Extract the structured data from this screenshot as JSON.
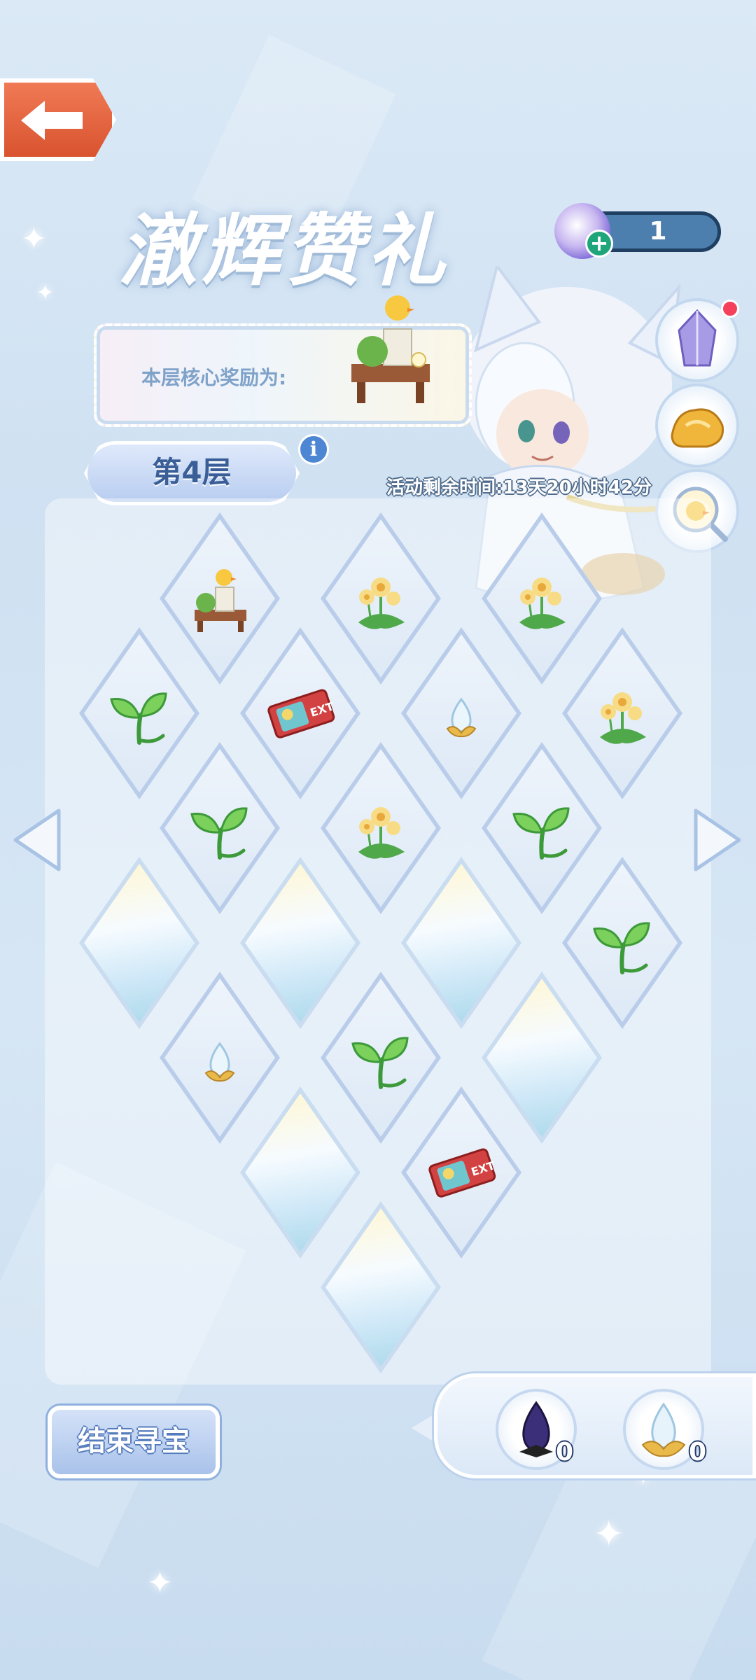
{
  "title": "澈辉赞礼",
  "currency": {
    "amount": "1",
    "icon": "crystal-orb-icon",
    "add_icon": "plus-icon"
  },
  "core_reward": {
    "label": "本层核心奖励为:",
    "item_icon": "garden-table-furniture-icon"
  },
  "layer": {
    "label": "第4层"
  },
  "timer": {
    "text": "活动剩余时间:13天20小时42分"
  },
  "side_buttons": [
    {
      "icon": "purple-crystal-icon",
      "has_notification": true
    },
    {
      "icon": "golden-rock-icon",
      "has_notification": false
    },
    {
      "icon": "magnifier-chick-icon",
      "has_notification": false
    }
  ],
  "board": {
    "tiles": [
      {
        "item": "garden-table"
      },
      {
        "item": "yellow-flower"
      },
      {
        "item": "yellow-flower"
      },
      {
        "item": "sprout"
      },
      {
        "item": "ticket"
      },
      {
        "item": "crystal-egg"
      },
      {
        "item": "yellow-flower"
      },
      {
        "item": "sprout"
      },
      {
        "item": "yellow-flower"
      },
      {
        "item": "sprout"
      },
      {
        "item": "hidden"
      },
      {
        "item": "hidden"
      },
      {
        "item": "hidden"
      },
      {
        "item": "sprout"
      },
      {
        "item": "crystal-egg"
      },
      {
        "item": "sprout"
      },
      {
        "item": "hidden"
      },
      {
        "item": "hidden"
      },
      {
        "item": "ticket"
      },
      {
        "item": "hidden"
      }
    ]
  },
  "end_button": {
    "label": "结束寻宝"
  },
  "inventory": [
    {
      "icon": "dark-crystal-icon",
      "count": "0"
    },
    {
      "icon": "gold-lotus-crystal-icon",
      "count": "0"
    }
  ],
  "colors": {
    "accent": "#4d7fae",
    "back_button": "#e0603a",
    "tile_border": "#b9cdea"
  }
}
